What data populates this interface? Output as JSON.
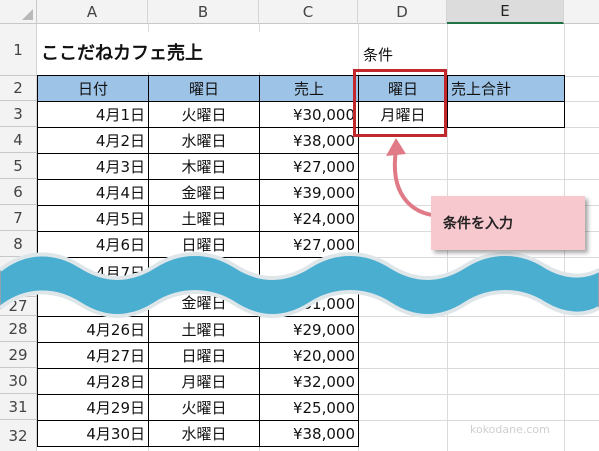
{
  "columns": [
    "A",
    "B",
    "C",
    "D",
    "E"
  ],
  "rows_top": [
    "1",
    "2",
    "3",
    "4",
    "5",
    "6",
    "7",
    "8"
  ],
  "rows_bottom": [
    "27",
    "28",
    "29",
    "30",
    "31",
    "32"
  ],
  "title": "ここだねカフェ売上",
  "condition_label": "条件",
  "headers": {
    "date": "日付",
    "weekday": "曜日",
    "sales": "売上",
    "cond_weekday": "曜日",
    "total": "売上合計"
  },
  "condition_value": "月曜日",
  "data_top": [
    {
      "date": "4月1日",
      "weekday": "火曜日",
      "sales": "¥30,000"
    },
    {
      "date": "4月2日",
      "weekday": "水曜日",
      "sales": "¥38,000"
    },
    {
      "date": "4月3日",
      "weekday": "木曜日",
      "sales": "¥27,000"
    },
    {
      "date": "4月4日",
      "weekday": "金曜日",
      "sales": "¥39,000"
    },
    {
      "date": "4月5日",
      "weekday": "土曜日",
      "sales": "¥24,000"
    },
    {
      "date": "4月6日",
      "weekday": "日曜日",
      "sales": "¥27,000"
    }
  ],
  "data_partial_top": {
    "date": "4月7日"
  },
  "data_partial_bottom": {
    "weekday": "金曜日",
    "sales": "¥31,000"
  },
  "data_bottom": [
    {
      "date": "4月26日",
      "weekday": "土曜日",
      "sales": "¥29,000"
    },
    {
      "date": "4月27日",
      "weekday": "日曜日",
      "sales": "¥20,000"
    },
    {
      "date": "4月28日",
      "weekday": "月曜日",
      "sales": "¥32,000"
    },
    {
      "date": "4月29日",
      "weekday": "火曜日",
      "sales": "¥25,000"
    },
    {
      "date": "4月30日",
      "weekday": "水曜日",
      "sales": "¥38,000"
    }
  ],
  "callout_text": "条件を入力",
  "watermark": "kokodane.com",
  "colors": {
    "header_fill": "#9dc3e6",
    "red_box": "#c0282e",
    "callout_fill": "#f8c8cf",
    "wave": "#4aaed0"
  }
}
